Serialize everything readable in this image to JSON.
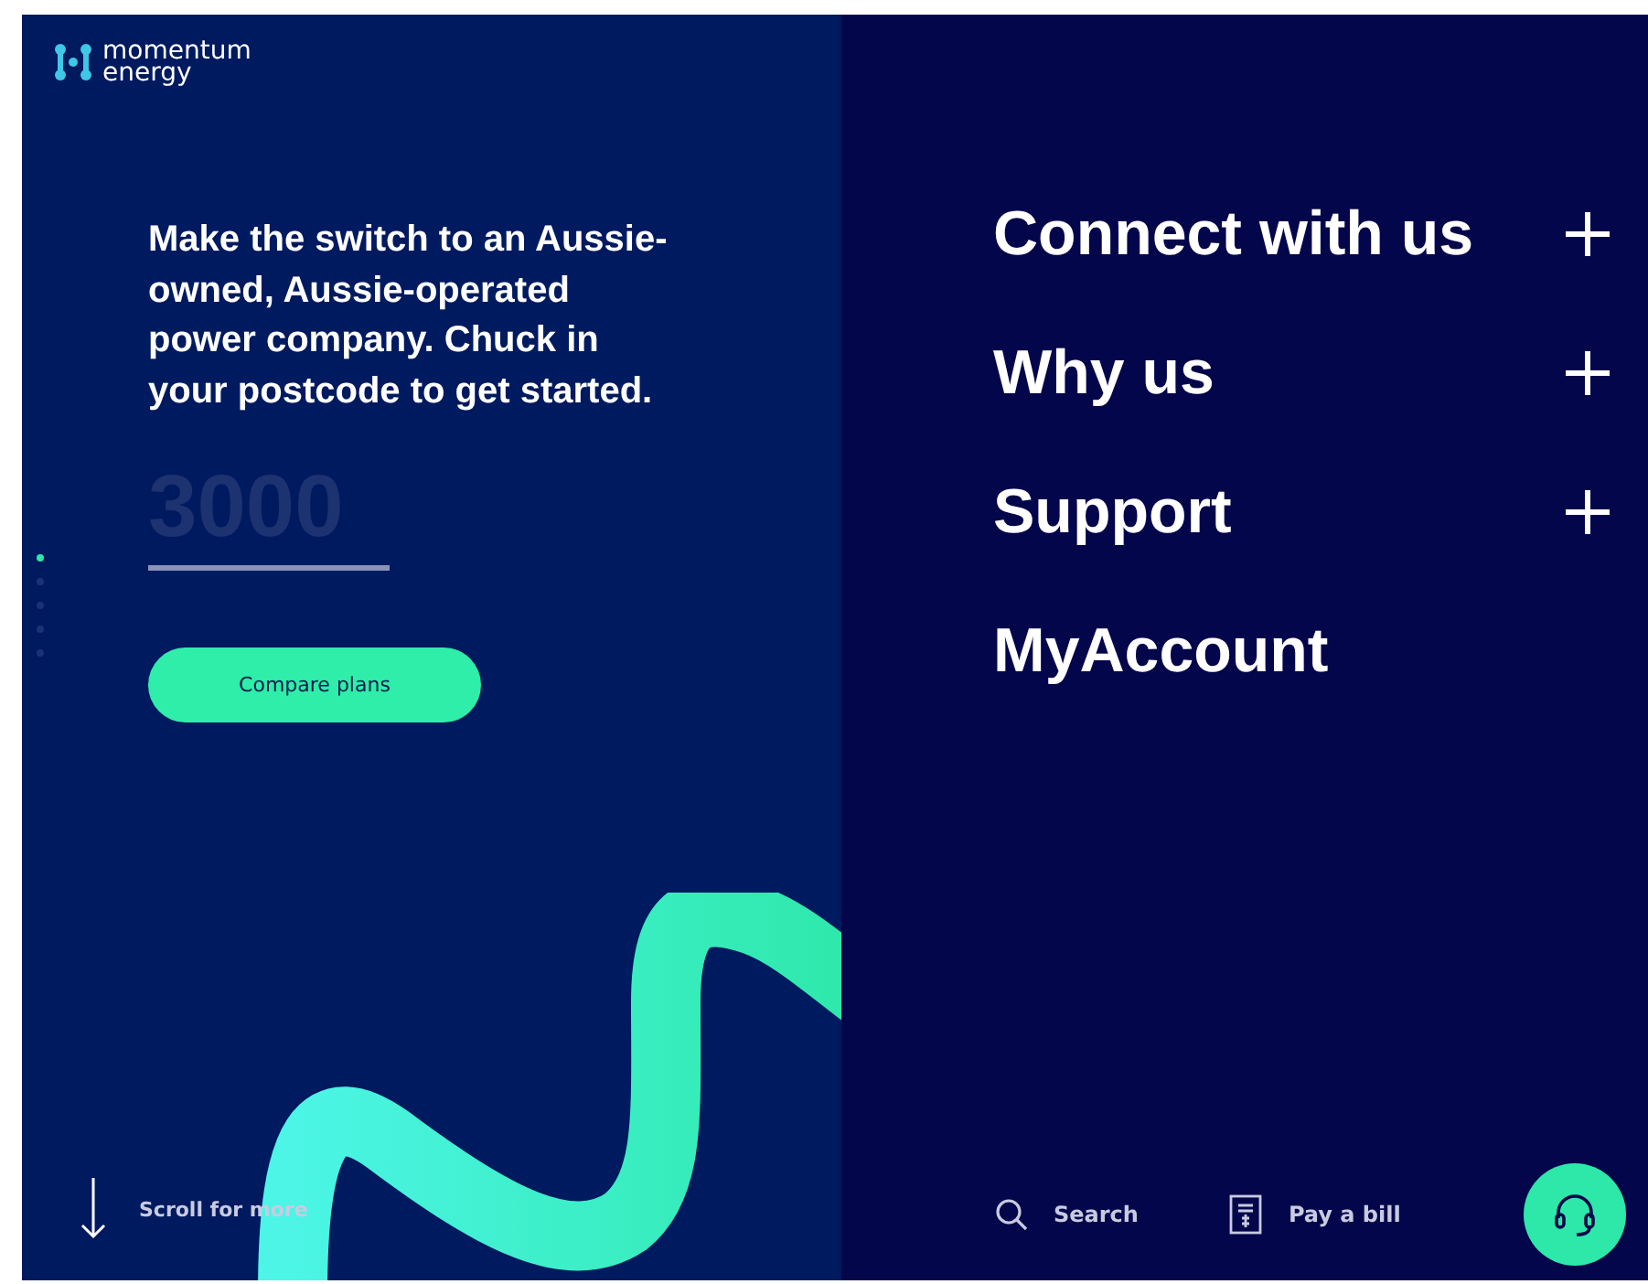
{
  "logo": {
    "line_1": "momentum",
    "line_2": "energy"
  },
  "intro": "Make the switch to an Aussie-owned, Aussie-operated power company. Chuck in your postcode to get started.",
  "postcode_field": {
    "placeholder": "3000"
  },
  "slides": [
    {
      "selected": true
    },
    {
      "selected": false
    },
    {
      "selected": false
    },
    {
      "selected": false
    },
    {
      "selected": false
    }
  ],
  "compare_button": "Compare plans",
  "scroll_hint": "Scroll for more",
  "nav": [
    {
      "label": "Connect with us",
      "expandable": true
    },
    {
      "label": "Why us",
      "expandable": true
    },
    {
      "label": "Support",
      "expandable": true
    },
    {
      "label": "MyAccount",
      "expandable": false
    }
  ],
  "footer_links": [
    {
      "kind": "search",
      "label": "Search"
    },
    {
      "kind": "bill",
      "label": "Pay a bill"
    }
  ]
}
